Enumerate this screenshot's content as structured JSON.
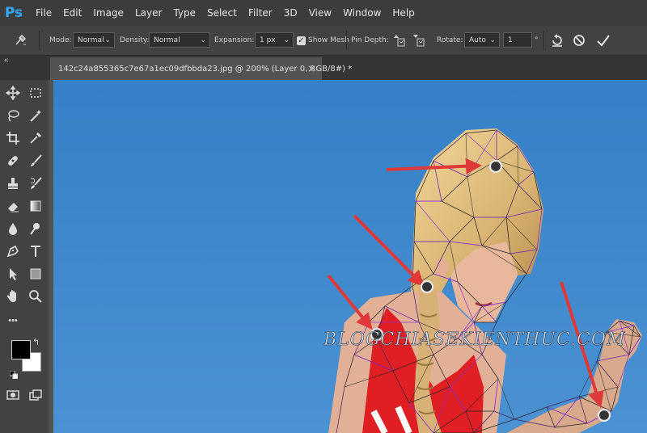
{
  "app": {
    "logo": "Ps"
  },
  "menu": [
    "File",
    "Edit",
    "Image",
    "Layer",
    "Type",
    "Select",
    "Filter",
    "3D",
    "View",
    "Window",
    "Help"
  ],
  "options": {
    "mode_label": "Mode:",
    "mode_value": "Normal",
    "density_label": "Density:",
    "density_value": "Normal",
    "expansion_label": "Expansion:",
    "expansion_value": "1 px",
    "show_mesh_label": "Show Mesh",
    "show_mesh_checked": true,
    "pin_depth_label": "Pin Depth:",
    "rotate_label": "Rotate:",
    "rotate_value": "Auto",
    "rotate_degrees": "1",
    "degree_symbol": "°"
  },
  "document": {
    "tab_title": "142c24a855365c7e67a1ec09dfbbda23.jpg @ 200% (Layer 0, RGB/8#) *",
    "close": "×"
  },
  "toolbox": {
    "collapse": "«",
    "more": "•••"
  },
  "watermark": "BLOGCHIASEKIENTHUC.COM",
  "colors": {
    "canvas_blue": "#3b85c9",
    "arrow_red": "#e0393a",
    "mesh_purple": "#8a2bd6"
  }
}
